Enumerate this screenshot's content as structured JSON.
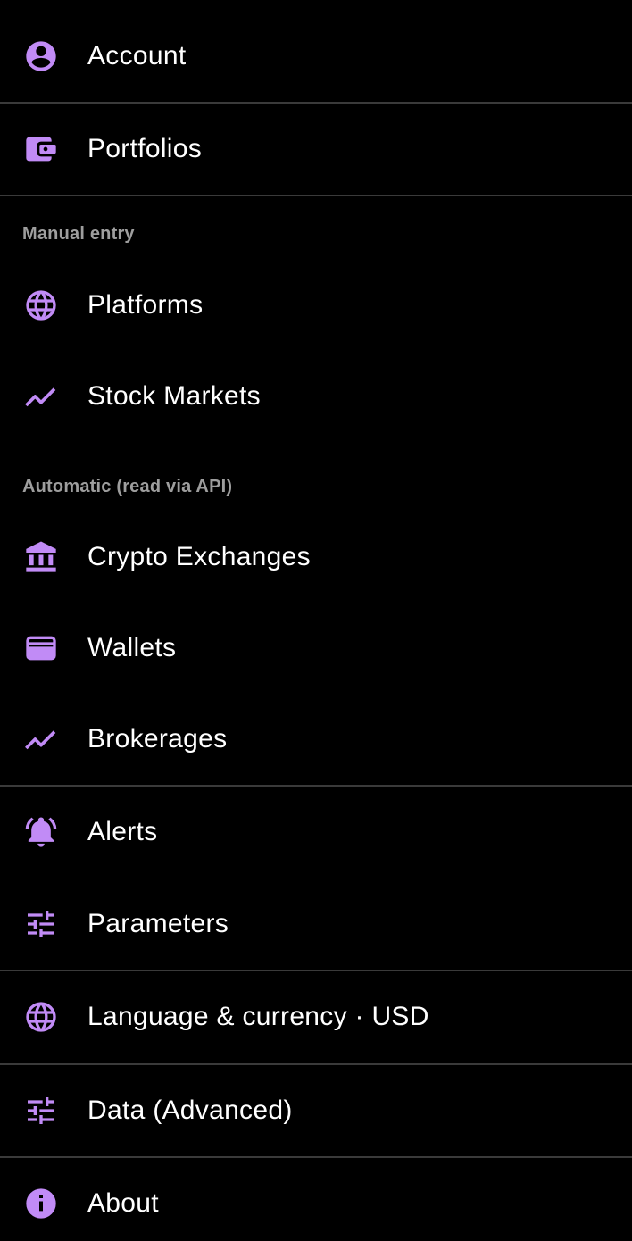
{
  "accent_color": "#c18bf6",
  "divider_color": "#3a3a3a",
  "section_header_color": "#9e9e9e",
  "menu": {
    "account": {
      "label": "Account",
      "icon": "account-circle-icon"
    },
    "portfolios": {
      "label": "Portfolios",
      "icon": "wallet-icon"
    },
    "manual_entry_header": "Manual entry",
    "platforms": {
      "label": "Platforms",
      "icon": "globe-icon"
    },
    "stock_markets": {
      "label": "Stock Markets",
      "icon": "trending-up-icon"
    },
    "automatic_header": "Automatic (read via API)",
    "crypto_exchanges": {
      "label": "Crypto Exchanges",
      "icon": "bank-icon"
    },
    "wallets": {
      "label": "Wallets",
      "icon": "card-wallet-icon"
    },
    "brokerages": {
      "label": "Brokerages",
      "icon": "trending-up-icon"
    },
    "alerts": {
      "label": "Alerts",
      "icon": "alarm-bell-icon"
    },
    "parameters": {
      "label": "Parameters",
      "icon": "tune-icon"
    },
    "language_currency": {
      "label": "Language & currency · USD",
      "icon": "globe-icon"
    },
    "data_advanced": {
      "label": "Data (Advanced)",
      "icon": "tune-icon"
    },
    "about": {
      "label": "About",
      "icon": "info-icon"
    }
  }
}
